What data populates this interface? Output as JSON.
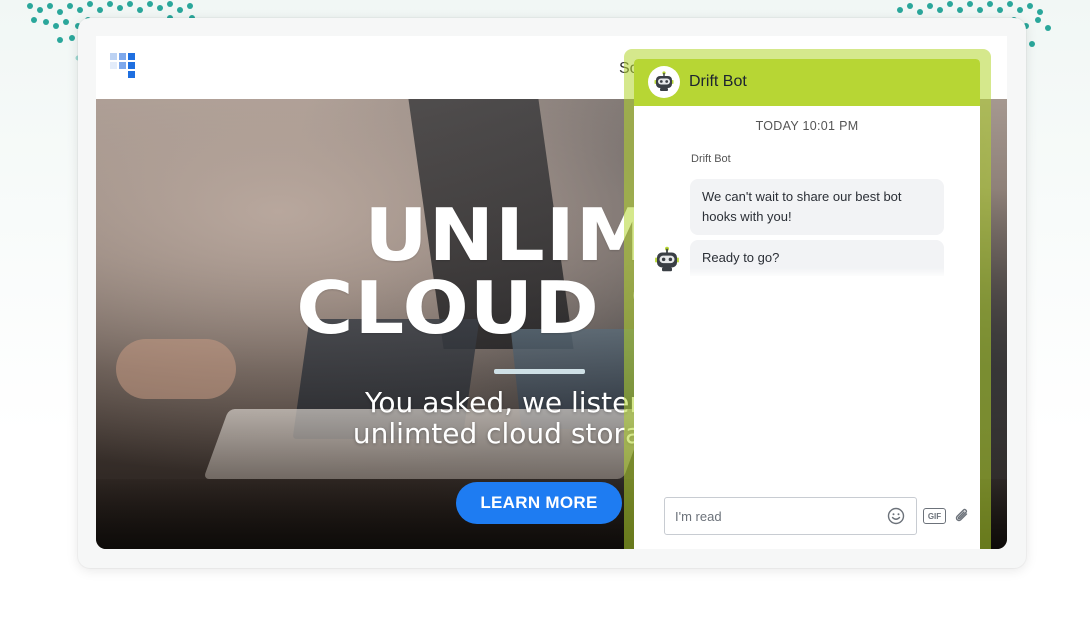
{
  "site": {
    "nav_partial_text": "So"
  },
  "hero": {
    "title_line1": "UNLIMIT",
    "title_line2": "CLOUD STO",
    "subtitle_line1": "You asked, we listened. No",
    "subtitle_line2": "unlimted cloud storage for y",
    "cta_label": "LEARN MORE"
  },
  "chat": {
    "header_title": "Drift Bot",
    "timestamp": "TODAY 10:01 PM",
    "sender_name": "Drift Bot",
    "messages": [
      {
        "text": "We can't wait to share our best bot hooks with you!"
      },
      {
        "text": "Ready to go?"
      }
    ],
    "input_value": "I'm read",
    "gif_label": "GIF"
  },
  "colors": {
    "chat_header": "#b7d634",
    "cta_blue": "#1e7cf2",
    "logo_blue": "#1e6fe0",
    "dots_teal": "#2aa79b"
  },
  "icons": {
    "logo": "grid-blocks-logo",
    "bot_avatar": "robot-icon",
    "emoji": "smiley-icon",
    "attach": "paperclip-icon"
  }
}
